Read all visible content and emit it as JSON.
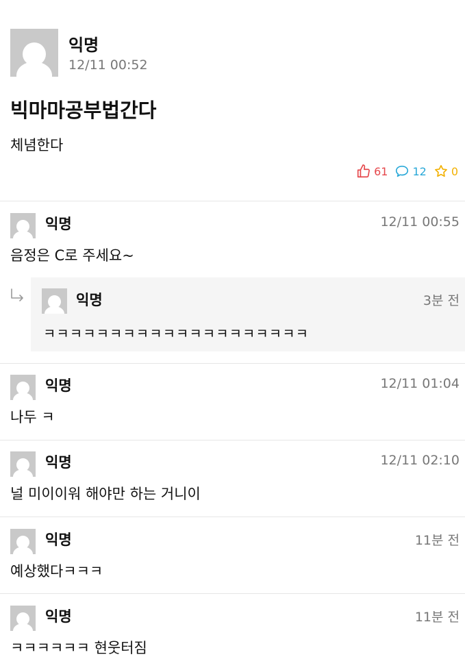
{
  "post": {
    "author": "익명",
    "time": "12/11 00:52",
    "title": "빅마마공부법간다",
    "body": "체념한다",
    "likes": "61",
    "comments": "12",
    "scraps": "0"
  },
  "comments": [
    {
      "author": "익명",
      "time": "12/11 00:55",
      "text": "음정은 C로 주세요~",
      "reply": {
        "author": "익명",
        "time": "3분 전",
        "text": "ㅋㅋㅋㅋㅋㅋㅋㅋㅋㅋㅋㅋㅋㅋㅋㅋㅋㅋㅋㅋ"
      }
    },
    {
      "author": "익명",
      "time": "12/11 01:04",
      "text": "나두 ㅋ"
    },
    {
      "author": "익명",
      "time": "12/11 02:10",
      "text": "널 미이이워 해야만 하는 거니이"
    },
    {
      "author": "익명",
      "time": "11분 전",
      "text": "예상했다ㅋㅋㅋ"
    },
    {
      "author": "익명",
      "time": "11분 전",
      "text": "ㅋㅋㅋㅋㅋㅋ 현웃터짐"
    }
  ],
  "colors": {
    "like": "#e5474b",
    "comment": "#29a8d8",
    "scrap": "#f2b000",
    "avatar_bg": "#c9c9c9",
    "reply_bg": "#f5f5f5"
  },
  "icons": {
    "like": "thumbs-up-icon",
    "comment": "speech-bubble-icon",
    "scrap": "star-icon",
    "reply": "reply-arrow-icon",
    "avatar": "default-avatar-icon"
  }
}
